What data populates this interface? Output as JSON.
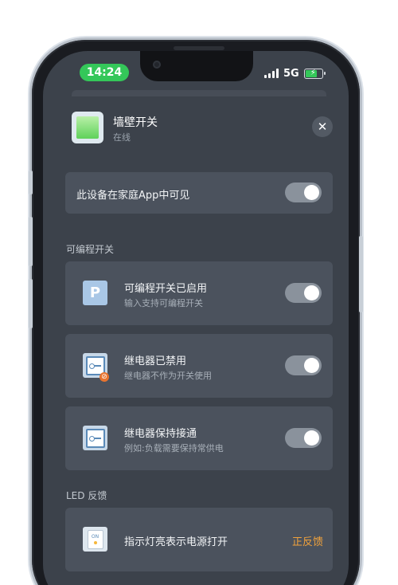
{
  "status_bar": {
    "time": "14:24",
    "network": "5G"
  },
  "device": {
    "name": "墙壁开关",
    "status": "在线",
    "close_icon": "✕"
  },
  "visibility": {
    "label": "此设备在家庭App中可见",
    "enabled": true
  },
  "programmable": {
    "section_title": "可编程开关",
    "items": [
      {
        "icon": "P",
        "label": "可编程开关已启用",
        "sub": "输入支持可编程开关",
        "enabled": true
      },
      {
        "label": "继电器已禁用",
        "sub": "继电器不作为开关使用",
        "enabled": true
      },
      {
        "label": "继电器保持接通",
        "sub": "例如:负载需要保持常供电",
        "enabled": true
      }
    ]
  },
  "led": {
    "section_title": "LED 反馈",
    "item": {
      "icon_text": "ON",
      "label": "指示灯亮表示电源打开",
      "value": "正反馈"
    }
  },
  "colors": {
    "background": "#3c424b",
    "card": "#4b525d",
    "accent_orange": "#f0a23c",
    "time_pill": "#34c759"
  }
}
